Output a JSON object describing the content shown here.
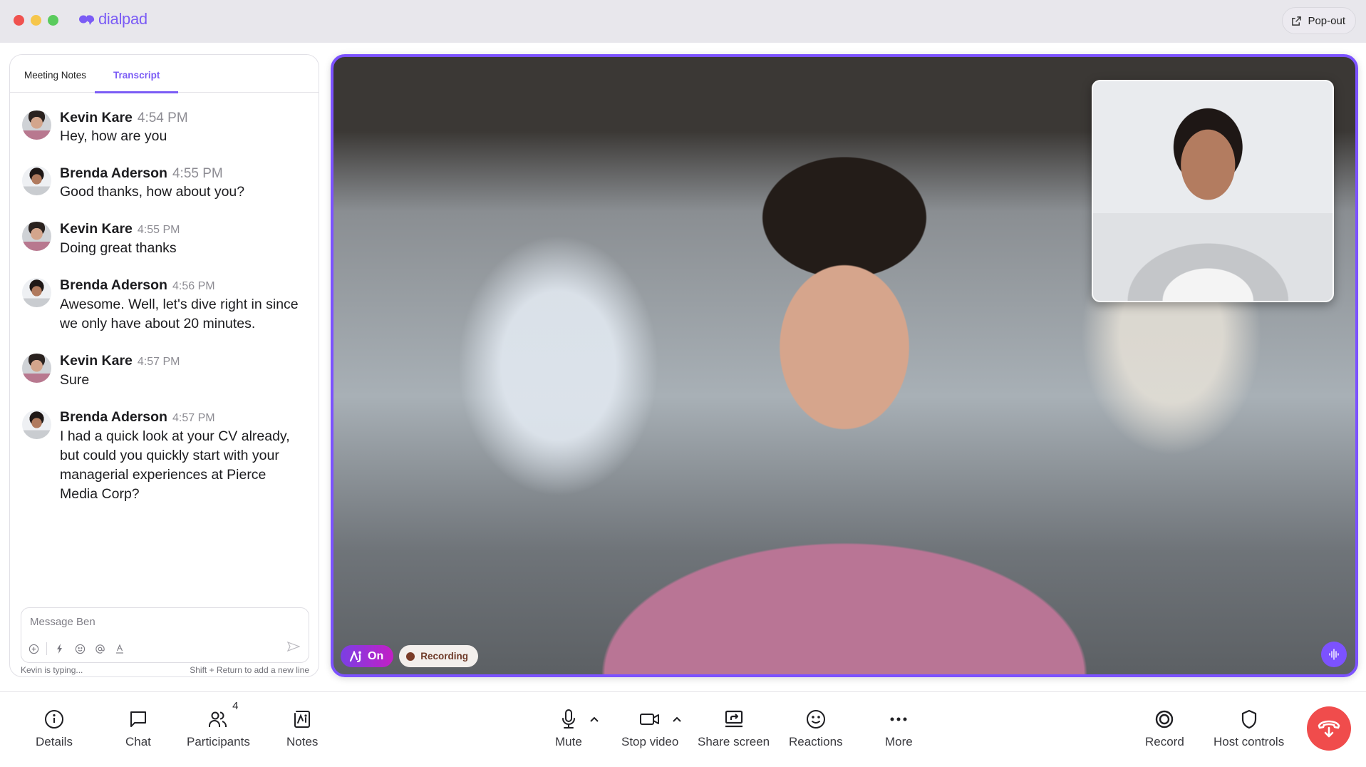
{
  "app": {
    "brand": "dialpad",
    "brand_color": "#7b5cf5",
    "popout_label": "Pop-out"
  },
  "panel": {
    "tabs": [
      {
        "label": "Meeting Notes",
        "active": false
      },
      {
        "label": "Transcript",
        "active": true
      }
    ],
    "messages": [
      {
        "name": "Kevin Kare",
        "time": "4:54 PM",
        "text": "Hey, how are you",
        "avatar": "kevin"
      },
      {
        "name": "Brenda Aderson",
        "time": "4:55 PM",
        "text": "Good thanks, how about you?",
        "avatar": "brenda"
      },
      {
        "name": "Kevin Kare",
        "time": "4:55 PM",
        "text": "Doing great thanks",
        "avatar": "kevin"
      },
      {
        "name": "Brenda Aderson",
        "time": "4:56 PM",
        "text": "Awesome. Well, let's dive right in since we only have about 20 minutes.",
        "avatar": "brenda"
      },
      {
        "name": "Kevin Kare",
        "time": "4:57 PM",
        "text": "Sure",
        "avatar": "kevin"
      },
      {
        "name": "Brenda Aderson",
        "time": "4:57 PM",
        "text": "I had a quick look at your CV already, but could you quickly start with your managerial experiences at Pierce Media Corp?",
        "avatar": "brenda"
      }
    ],
    "composer": {
      "placeholder": "Message Ben",
      "typing_status": "Kevin is typing...",
      "hint": "Shift + Return to add a new line"
    }
  },
  "video": {
    "main_participant": "Kevin Kare",
    "pip_participant": "Brenda Aderson",
    "ai_badge_label": "On",
    "recording_label": "Recording",
    "border_color": "#7c52ff"
  },
  "toolbar": {
    "left": [
      {
        "label": "Details",
        "icon": "info-icon"
      },
      {
        "label": "Chat",
        "icon": "chat-icon"
      },
      {
        "label": "Participants",
        "icon": "participants-icon",
        "count": "4"
      },
      {
        "label": "Notes",
        "icon": "notes-icon"
      }
    ],
    "center": [
      {
        "label": "Mute",
        "icon": "microphone-icon"
      },
      {
        "label": "Stop video",
        "icon": "video-camera-icon"
      },
      {
        "label": "Share screen",
        "icon": "share-screen-icon"
      },
      {
        "label": "Reactions",
        "icon": "smiley-icon"
      },
      {
        "label": "More",
        "icon": "more-icon"
      }
    ],
    "right": [
      {
        "label": "Record",
        "icon": "record-icon"
      },
      {
        "label": "Host controls",
        "icon": "shield-icon"
      }
    ],
    "hangup_color": "#f04c4c"
  }
}
